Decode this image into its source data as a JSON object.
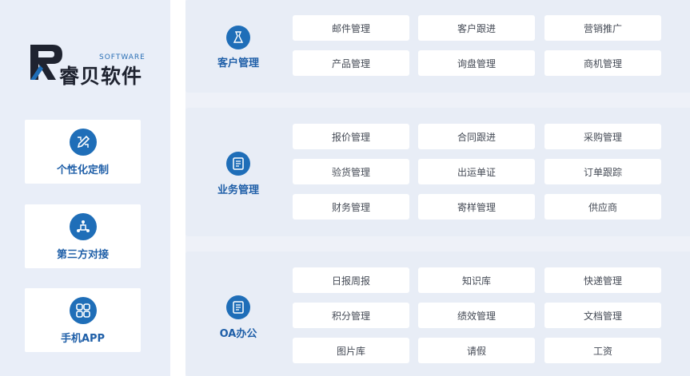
{
  "brand": {
    "name": "睿贝软件",
    "software_tag": "SOFTWARE",
    "primary_color": "#1f6eb8",
    "logo_dark": "#1f2330"
  },
  "sidebar": {
    "features": [
      {
        "label": "个性化定制",
        "icon": "pencil-ruler-icon"
      },
      {
        "label": "第三方对接",
        "icon": "network-nodes-icon"
      },
      {
        "label": "手机APP",
        "icon": "app-grid-icon"
      }
    ]
  },
  "sections": [
    {
      "title": "客户管理",
      "icon": "customer-icon",
      "items": [
        "邮件管理",
        "客户跟进",
        "营销推广",
        "产品管理",
        "询盘管理",
        "商机管理"
      ]
    },
    {
      "title": "业务管理",
      "icon": "business-icon",
      "items": [
        "报价管理",
        "合同跟进",
        "采购管理",
        "验货管理",
        "出运单证",
        "订单跟踪",
        "财务管理",
        "寄样管理",
        "供应商"
      ]
    },
    {
      "title": "OA办公",
      "icon": "office-icon",
      "items": [
        "日报周报",
        "知识库",
        "快递管理",
        "积分管理",
        "绩效管理",
        "文档管理",
        "图片库",
        "请假",
        "工资"
      ]
    }
  ]
}
